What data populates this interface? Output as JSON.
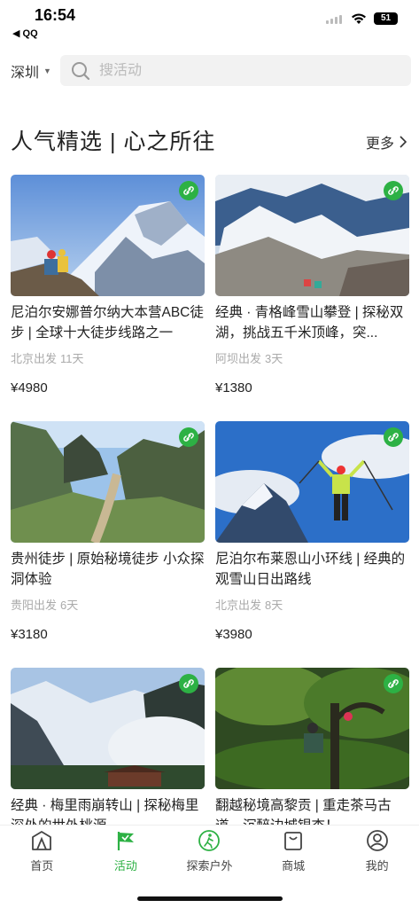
{
  "status_bar": {
    "time": "16:54",
    "back_app": "◀ QQ",
    "battery": "51"
  },
  "search": {
    "city": "深圳",
    "placeholder": "搜活动"
  },
  "section": {
    "title": "人气精选 | 心之所往",
    "more_label": "更多"
  },
  "cards": [
    {
      "title": "尼泊尔安娜普尔纳大本营ABC徒步 | 全球十大徒步线路之一",
      "depart": "北京出发",
      "days": "11天",
      "price": "¥4980"
    },
    {
      "title": "经典 · 青格峰雪山攀登 | 探秘双湖，挑战五千米顶峰，突...",
      "depart": "阿坝出发",
      "days": "3天",
      "price": "¥1380"
    },
    {
      "title": "贵州徒步 | 原始秘境徒步 小众探洞体验",
      "depart": "贵阳出发",
      "days": "6天",
      "price": "¥3180"
    },
    {
      "title": "尼泊尔布莱恩山小环线 | 经典的观雪山日出路线",
      "depart": "北京出发",
      "days": "8天",
      "price": "¥3980"
    },
    {
      "title": "经典 · 梅里雨崩转山 | 探秘梅里深处的世外桃源",
      "depart": "",
      "days": "",
      "price": ""
    },
    {
      "title": "翻越秘境高黎贡 | 重走茶马古道，沉醉边城银杏！",
      "depart": "",
      "days": "",
      "price": ""
    }
  ],
  "tabs": [
    {
      "label": "首页",
      "icon": "home-icon"
    },
    {
      "label": "活动",
      "icon": "flag-icon"
    },
    {
      "label": "探索户外",
      "icon": "hiker-icon"
    },
    {
      "label": "商城",
      "icon": "shopping-bag-icon"
    },
    {
      "label": "我的",
      "icon": "profile-icon"
    }
  ],
  "colors": {
    "accent": "#2db144",
    "text": "#222222",
    "muted": "#aaaaaa"
  }
}
